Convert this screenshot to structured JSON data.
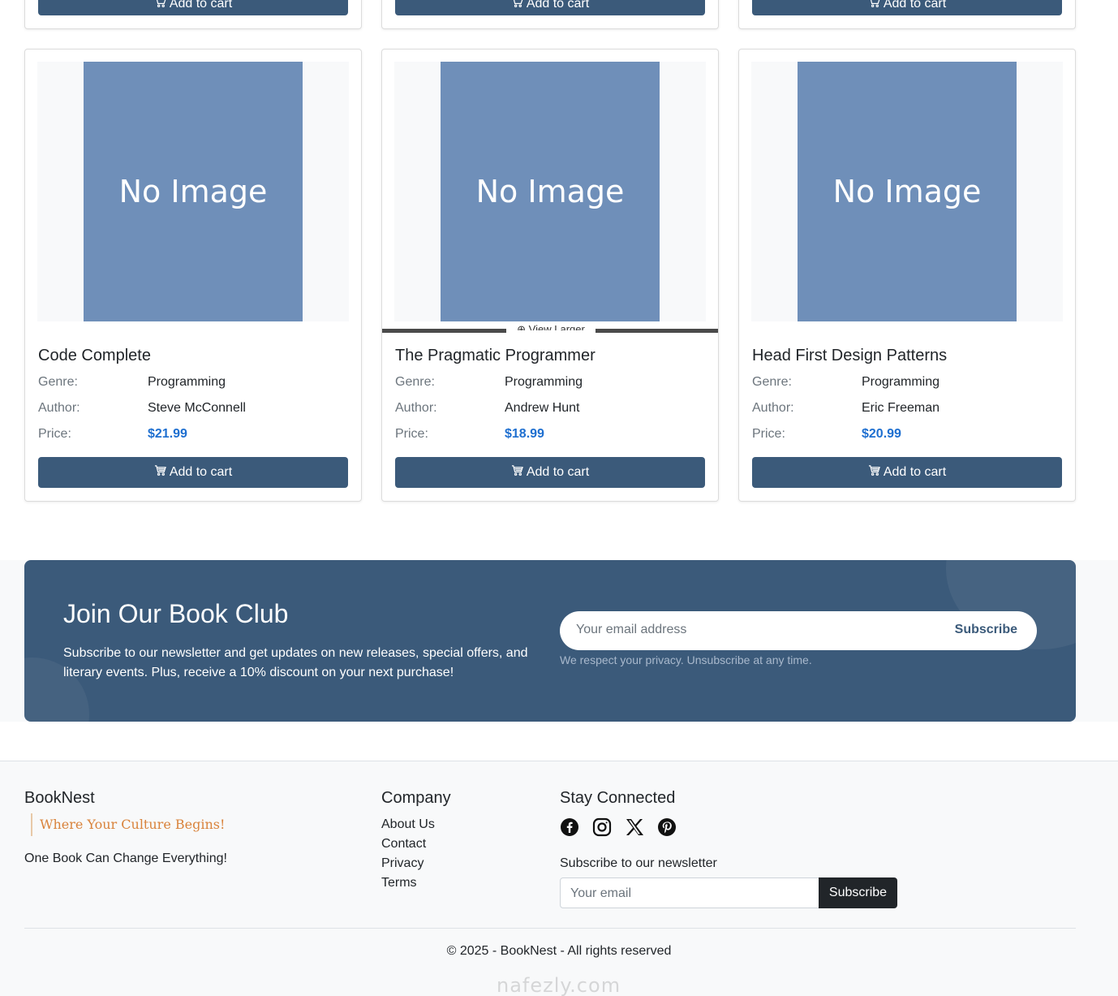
{
  "top_cards": [
    {
      "cart_label": "Add to cart"
    },
    {
      "cart_label": "Add to cart"
    },
    {
      "cart_label": "Add to cart"
    }
  ],
  "books": [
    {
      "image_text": "No Image",
      "title": "Code Complete",
      "genre_label": "Genre:",
      "genre": "Programming",
      "author_label": "Author:",
      "author": "Steve McConnell",
      "price_label": "Price:",
      "price": "$21.99",
      "cart_label": "Add to cart"
    },
    {
      "image_text": "No Image",
      "title": "The Pragmatic Programmer",
      "genre_label": "Genre:",
      "genre": "Programming",
      "author_label": "Author:",
      "author": "Andrew Hunt",
      "price_label": "Price:",
      "price": "$18.99",
      "cart_label": "Add to cart",
      "overlay_label": "⊕ View Larger"
    },
    {
      "image_text": "No Image",
      "title": "Head First Design Patterns",
      "genre_label": "Genre:",
      "genre": "Programming",
      "author_label": "Author:",
      "author": "Eric Freeman",
      "price_label": "Price:",
      "price": "$20.99",
      "cart_label": "Add to cart"
    }
  ],
  "newsletter": {
    "title": "Join Our Book Club",
    "text": "Subscribe to our newsletter and get updates on new releases, special offers, and literary events. Plus, receive a 10% discount on your next purchase!",
    "placeholder": "Your email address",
    "button": "Subscribe",
    "note": "We respect your privacy. Unsubscribe at any time."
  },
  "footer": {
    "brand": "BookNest",
    "tagline": "Where Your Culture Begins!",
    "motto": "One Book Can Change Everything!",
    "company_title": "Company",
    "links": [
      "About Us",
      "Contact",
      "Privacy",
      "Terms"
    ],
    "stay_title": "Stay Connected",
    "social": [
      "facebook-icon",
      "instagram-icon",
      "x-icon",
      "pinterest-icon"
    ],
    "subscribe_label": "Subscribe to our newsletter",
    "email_placeholder": "Your email",
    "subscribe_button": "Subscribe",
    "copyright": "© 2025 - BookNest - All rights reserved",
    "watermark": "nafezly.com"
  },
  "colors": {
    "primary": "#3b5a7a",
    "price": "#1e6fd0",
    "placeholder_image": "#6f8fb9",
    "tagline": "#d9833b"
  }
}
